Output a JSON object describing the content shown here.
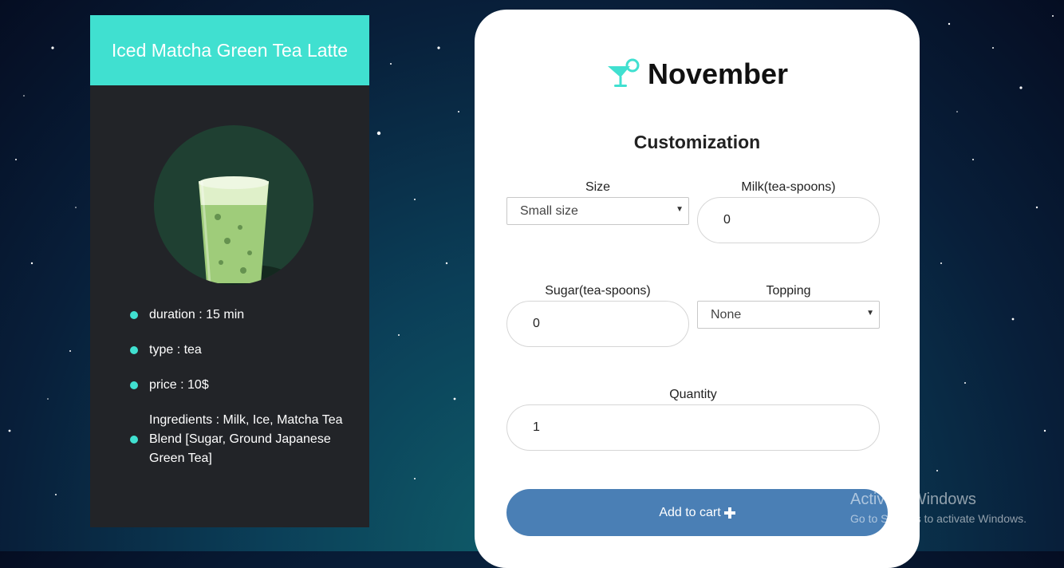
{
  "product": {
    "title": "Iced Matcha Green Tea Latte",
    "details": [
      "duration : 15 min",
      "type : tea",
      "price : 10$",
      "Ingredients : Milk, Ice, Matcha Tea Blend [Sugar, Ground Japanese Green Tea]"
    ]
  },
  "brand": {
    "name": "November",
    "icon": "cocktail-icon"
  },
  "customization": {
    "title": "Customization",
    "size": {
      "label": "Size",
      "value": "Small size"
    },
    "milk": {
      "label": "Milk(tea-spoons)",
      "value": "0"
    },
    "sugar": {
      "label": "Sugar(tea-spoons)",
      "value": "0"
    },
    "topping": {
      "label": "Topping",
      "value": "None"
    },
    "quantity": {
      "label": "Quantity",
      "value": "1"
    },
    "add_to_cart": "Add to cart"
  },
  "watermark": {
    "line1": "Activate Windows",
    "line2": "Go to Settings to activate Windows."
  },
  "colors": {
    "accent": "#40e0d0",
    "button": "#4a7fb5",
    "card_bg": "#222428"
  }
}
